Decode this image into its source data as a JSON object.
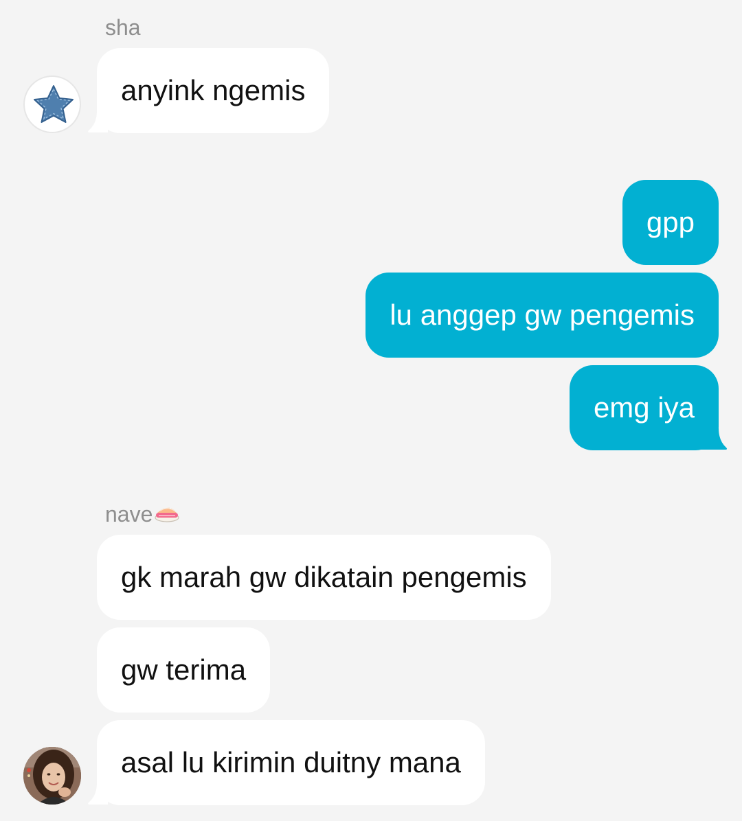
{
  "conversation": {
    "sender_1": {
      "name": "sha",
      "avatar_icon": "star-icon",
      "messages": [
        "anyink ngemis"
      ]
    },
    "me": {
      "bubble_color": "#02b0d2",
      "messages": [
        "gpp",
        "lu anggep gw pengemis",
        "emg iya"
      ]
    },
    "sender_2": {
      "name": "nave",
      "name_emoji_icon": "sushi-icon",
      "avatar_icon": "profile-photo",
      "messages": [
        "gk marah gw dikatain pengemis",
        "gw terima",
        "asal lu kirimin duitny mana"
      ]
    }
  },
  "colors": {
    "background": "#f4f4f4",
    "incoming_bubble": "#ffffff",
    "outgoing_bubble": "#02b0d2",
    "name_text": "#8e8e8e"
  }
}
